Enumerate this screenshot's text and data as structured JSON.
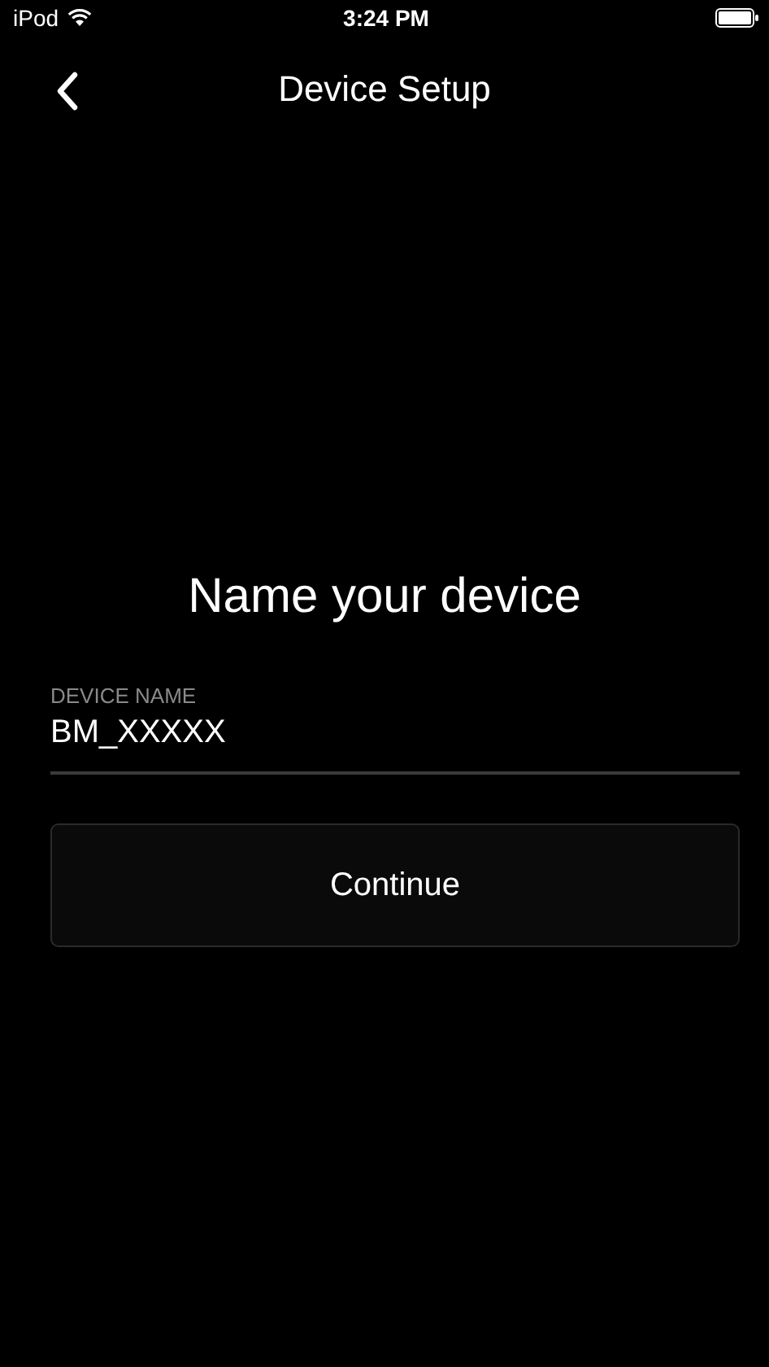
{
  "status_bar": {
    "carrier": "iPod",
    "time": "3:24 PM"
  },
  "nav": {
    "title": "Device Setup"
  },
  "heading": "Name your device",
  "field": {
    "label": "DEVICE NAME",
    "value": "BM_XXXXX"
  },
  "button": {
    "label": "Continue"
  }
}
